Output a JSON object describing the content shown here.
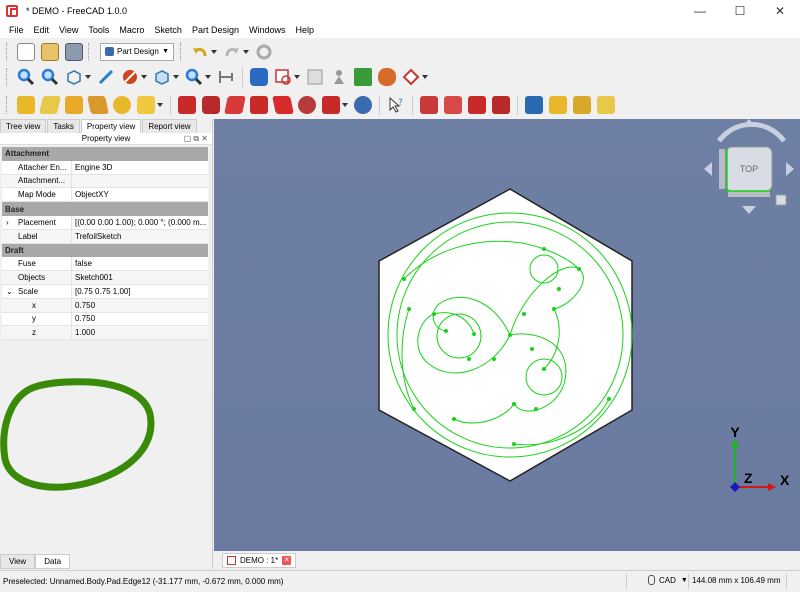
{
  "window": {
    "title": "* DEMO - FreeCAD 1.0.0",
    "minimize_glyph": "—",
    "maximize_glyph": "☐",
    "close_glyph": "✕"
  },
  "menu": [
    "File",
    "Edit",
    "View",
    "Tools",
    "Macro",
    "Sketch",
    "Part Design",
    "Windows",
    "Help"
  ],
  "toolbar": {
    "workbench": "Part Design"
  },
  "panel_tabs": [
    "Tree view",
    "Tasks",
    "Property view",
    "Report view"
  ],
  "property_view": {
    "header": "Property view",
    "groups": {
      "attachment": "Attachment",
      "base": "Base",
      "draft": "Draft"
    },
    "rows": {
      "attacher_engine": {
        "key": "Attacher En...",
        "value": "Engine 3D"
      },
      "attachment": {
        "key": "Attachment...",
        "value": ""
      },
      "map_mode": {
        "key": "Map Mode",
        "value": "ObjectXY"
      },
      "placement": {
        "key": "Placement",
        "value": "[(0.00 0.00 1.00); 0.000 °; (0.000 m..."
      },
      "label": {
        "key": "Label",
        "value": "TrefoilSketch"
      },
      "fuse": {
        "key": "Fuse",
        "value": "false"
      },
      "objects": {
        "key": "Objects",
        "value": "Sketch001"
      },
      "scale": {
        "key": "Scale",
        "value": "[0.75 0.75 1.00]"
      },
      "x": {
        "key": "x",
        "value": "0.750"
      },
      "y": {
        "key": "y",
        "value": "0.750"
      },
      "z": {
        "key": "z",
        "value": "1.000"
      }
    }
  },
  "bottom_tabs": [
    "View",
    "Data"
  ],
  "navcube": {
    "face_label": "TOP"
  },
  "axes": {
    "x": "X",
    "y": "Y",
    "z": "Z"
  },
  "document_tab": "DEMO : 1*",
  "status": {
    "message": "Preselected: Unnamed.Body.Pad.Edge12 (-31.177 mm, -0.672 mm, 0.000 mm)",
    "nav_style": "CAD",
    "dimensions": "144.08 mm x 106.49 mm"
  },
  "colors": {
    "view_bg": "#6b7ba1",
    "sketch": "#19d219",
    "annotation": "#3a8a0a",
    "group_header": "#a8a8a8"
  }
}
